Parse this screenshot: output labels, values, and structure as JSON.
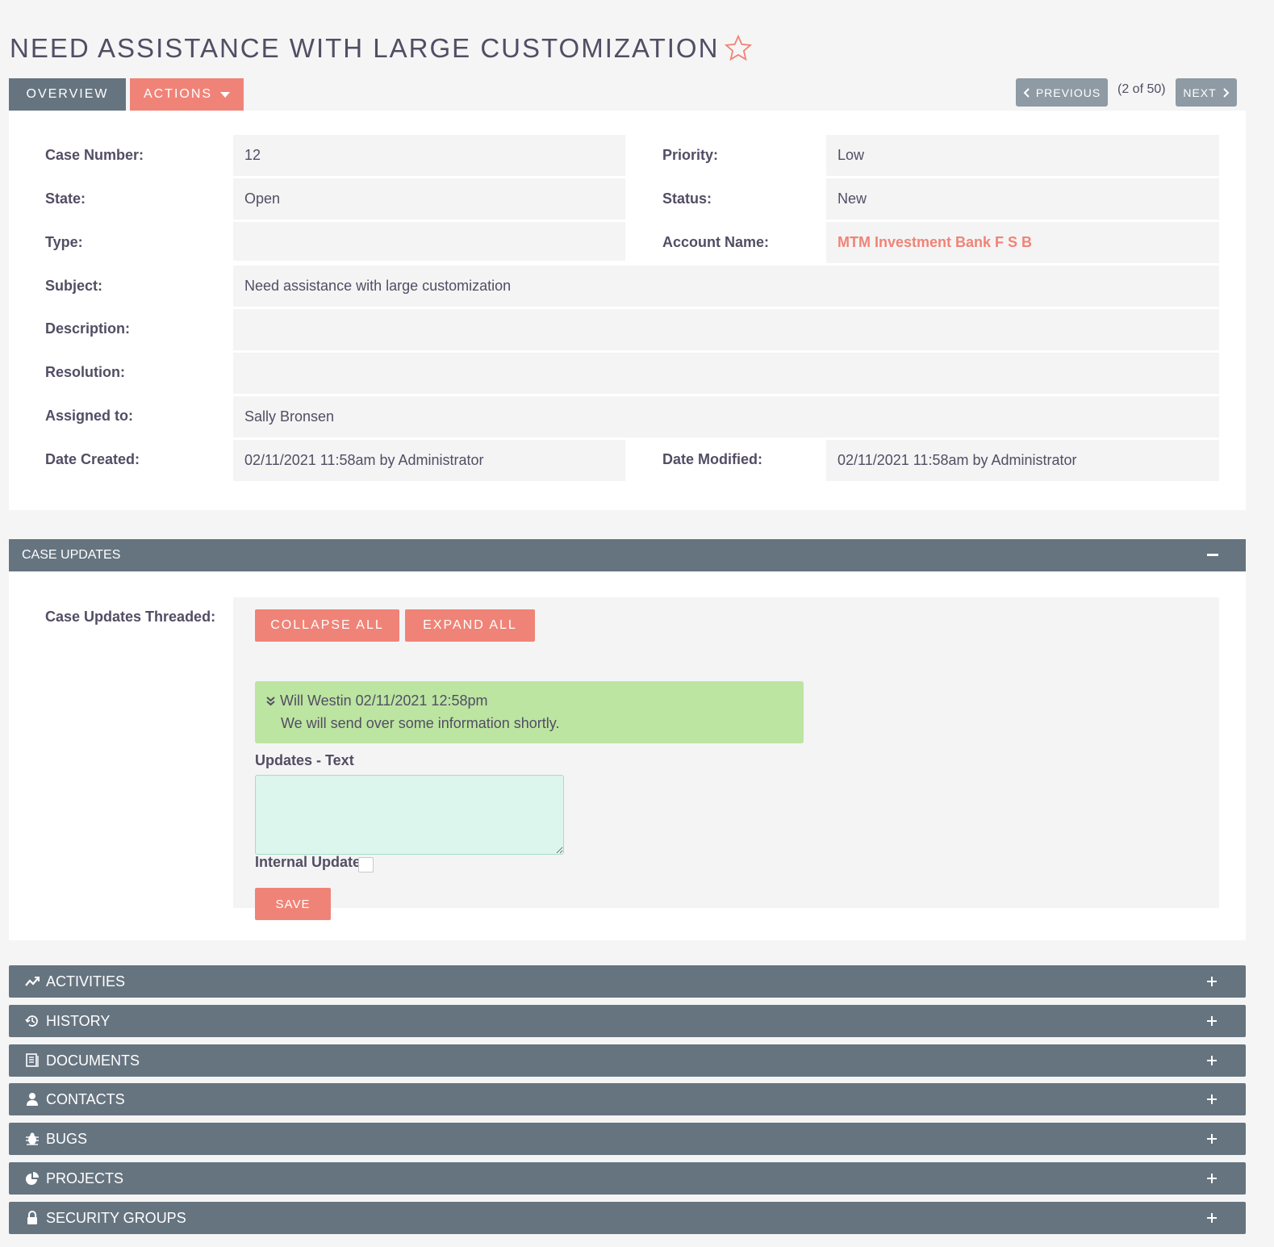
{
  "header": {
    "title": "NEED ASSISTANCE WITH LARGE CUSTOMIZATION"
  },
  "tabs": {
    "overview": "OVERVIEW",
    "actions": "ACTIONS"
  },
  "pagination": {
    "previous": "PREVIOUS",
    "count": "(2 of 50)",
    "next": "NEXT"
  },
  "fields": {
    "case_number": {
      "label": "Case Number:",
      "value": "12"
    },
    "priority": {
      "label": "Priority:",
      "value": "Low"
    },
    "state": {
      "label": "State:",
      "value": "Open"
    },
    "status": {
      "label": "Status:",
      "value": "New"
    },
    "type": {
      "label": "Type:",
      "value": ""
    },
    "account_name": {
      "label": "Account Name:",
      "value": "MTM Investment Bank F S B"
    },
    "subject": {
      "label": "Subject:",
      "value": "Need assistance with large customization"
    },
    "description": {
      "label": "Description:",
      "value": ""
    },
    "resolution": {
      "label": "Resolution:",
      "value": ""
    },
    "assigned_to": {
      "label": "Assigned to:",
      "value": "Sally Bronsen"
    },
    "date_created": {
      "label": "Date Created:",
      "value": "02/11/2021 11:58am by Administrator"
    },
    "date_modified": {
      "label": "Date Modified:",
      "value": "02/11/2021 11:58am by Administrator"
    }
  },
  "case_updates": {
    "header": "CASE UPDATES",
    "label": "Case Updates Threaded:",
    "collapse_all": "COLLAPSE ALL",
    "expand_all": "EXPAND ALL",
    "thread": {
      "author_date": "Will Westin 02/11/2021 12:58pm",
      "text": "We will send over some information shortly."
    },
    "updates_text_label": "Updates - Text",
    "internal_update_label": "Internal Update",
    "save": "SAVE"
  },
  "subpanels": {
    "activities": "ACTIVITIES",
    "history": "HISTORY",
    "documents": "DOCUMENTS",
    "contacts": "CONTACTS",
    "bugs": "BUGS",
    "projects": "PROJECTS",
    "security_groups": "SECURITY GROUPS"
  },
  "colors": {
    "accent": "#f08377",
    "panel_header": "#667480",
    "thread_bg": "#bce5a1"
  }
}
